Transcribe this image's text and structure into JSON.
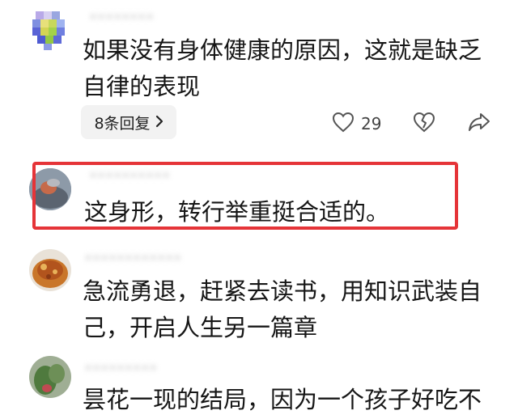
{
  "comments": [
    {
      "username": "••••••••",
      "meta": "",
      "text_line1": "如果没有身体健康的原因，这就是缺乏",
      "text_line2": "自律的表现",
      "reply_label": "8条回复",
      "like_count": "29"
    },
    {
      "username": "••••••••••",
      "meta": "",
      "text_line1": "这身形，转行举重挺合适的。"
    },
    {
      "username": "••••••••••••",
      "meta": "",
      "text_line1": "急流勇退，赶紧去读书，用知识武装自",
      "text_line2": "己，开启人生另一篇章"
    },
    {
      "username": "•••••••••",
      "meta": "",
      "text_line1": "昙花一现的结局，因为一个孩子好吃不"
    }
  ],
  "icons": {
    "reply_chevron": "chevron-right-icon",
    "like": "heart-icon",
    "dislike": "broken-heart-icon",
    "share": "share-icon"
  },
  "colors": {
    "highlight": "#e53438",
    "reply_bg": "#f2f2f2",
    "text": "#161616"
  }
}
